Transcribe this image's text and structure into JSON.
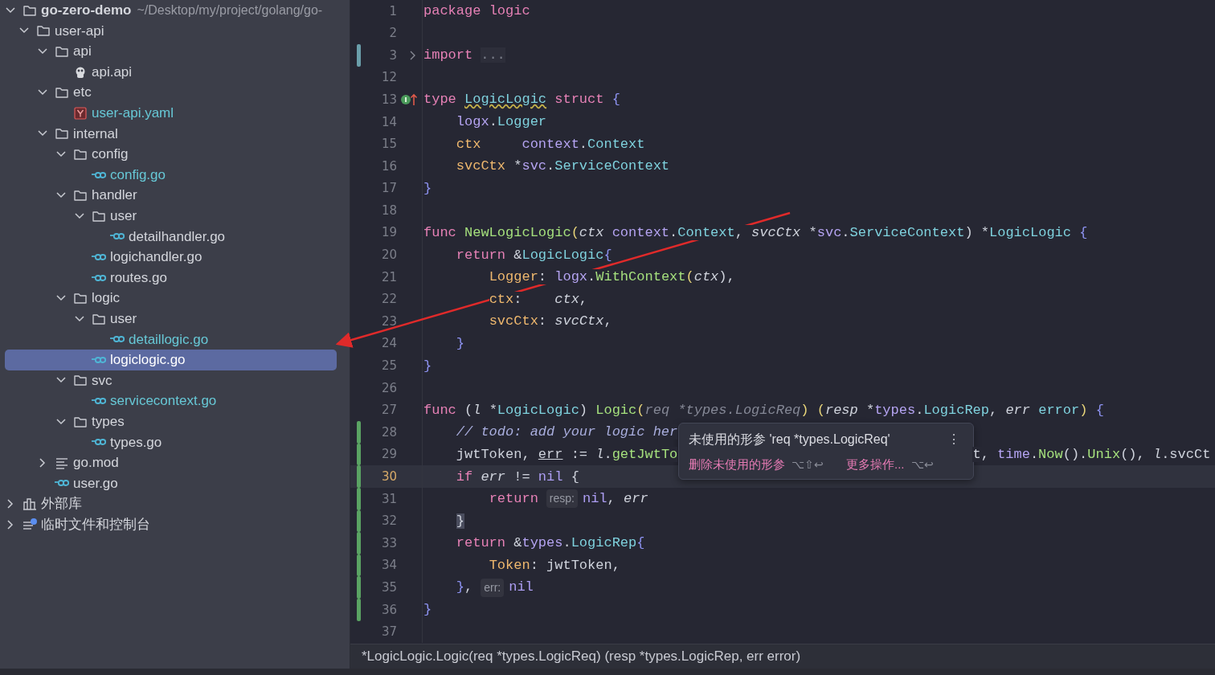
{
  "tree": [
    {
      "name": "go-zero-demo",
      "path": "~/Desktop/my/project/golang/go-",
      "kind": "folder",
      "expanded": true,
      "selected": false,
      "children": [
        {
          "name": "user-api",
          "kind": "folder",
          "expanded": true,
          "selected": false,
          "children": [
            {
              "name": "api",
              "kind": "folder",
              "expanded": true,
              "selected": false,
              "children": [
                {
                  "name": "api.api",
                  "kind": "api",
                  "selected": false,
                  "vcs_new": false
                }
              ]
            },
            {
              "name": "etc",
              "kind": "folder",
              "expanded": true,
              "selected": false,
              "children": [
                {
                  "name": "user-api.yaml",
                  "kind": "yaml",
                  "selected": false,
                  "vcs_new": true
                }
              ]
            },
            {
              "name": "internal",
              "kind": "folder",
              "expanded": true,
              "selected": false,
              "children": [
                {
                  "name": "config",
                  "kind": "folder",
                  "expanded": true,
                  "selected": false,
                  "children": [
                    {
                      "name": "config.go",
                      "kind": "go",
                      "selected": false,
                      "vcs_new": true
                    }
                  ]
                },
                {
                  "name": "handler",
                  "kind": "folder",
                  "expanded": true,
                  "selected": false,
                  "children": [
                    {
                      "name": "user",
                      "kind": "folder",
                      "expanded": true,
                      "selected": false,
                      "children": [
                        {
                          "name": "detailhandler.go",
                          "kind": "go",
                          "selected": false,
                          "vcs_new": false
                        }
                      ]
                    },
                    {
                      "name": "logichandler.go",
                      "kind": "go",
                      "selected": false,
                      "vcs_new": false
                    },
                    {
                      "name": "routes.go",
                      "kind": "go",
                      "selected": false,
                      "vcs_new": false
                    }
                  ]
                },
                {
                  "name": "logic",
                  "kind": "folder",
                  "expanded": true,
                  "selected": false,
                  "children": [
                    {
                      "name": "user",
                      "kind": "folder",
                      "expanded": true,
                      "selected": false,
                      "children": [
                        {
                          "name": "detaillogic.go",
                          "kind": "go",
                          "selected": false,
                          "vcs_new": true
                        }
                      ]
                    },
                    {
                      "name": "logiclogic.go",
                      "kind": "go",
                      "selected": true,
                      "vcs_new": false
                    }
                  ]
                },
                {
                  "name": "svc",
                  "kind": "folder",
                  "expanded": true,
                  "selected": false,
                  "children": [
                    {
                      "name": "servicecontext.go",
                      "kind": "go",
                      "selected": false,
                      "vcs_new": true
                    }
                  ]
                },
                {
                  "name": "types",
                  "kind": "folder",
                  "expanded": true,
                  "selected": false,
                  "children": [
                    {
                      "name": "types.go",
                      "kind": "go",
                      "selected": false,
                      "vcs_new": false
                    }
                  ]
                }
              ]
            },
            {
              "name": "go.mod",
              "kind": "mod",
              "expanded": false,
              "selected": false
            },
            {
              "name": "user.go",
              "kind": "go",
              "selected": false,
              "vcs_new": false
            }
          ]
        }
      ]
    },
    {
      "name": "外部库",
      "kind": "library",
      "expanded": false,
      "selected": false
    },
    {
      "name": "临时文件和控制台",
      "kind": "scratch",
      "expanded": false,
      "selected": false
    }
  ],
  "lines": [
    {
      "n": "1",
      "t": [
        {
          "text": "package",
          "kind": "kw"
        },
        {
          "text": " logic",
          "kind": "kw"
        }
      ]
    },
    {
      "n": "2"
    },
    {
      "n": "3",
      "folded": true,
      "color": "#6a9eaa",
      "t": [
        {
          "text": "import",
          "kind": "kw"
        },
        {
          "text": "...",
          "kind": "fold"
        }
      ]
    },
    {
      "n": "12"
    },
    {
      "n": "13",
      "implements_marker": true,
      "t": [
        {
          "text": "type ",
          "kind": "kw"
        },
        {
          "text": "LogicLogic",
          "kind": "typew"
        },
        {
          "text": " struct",
          "kind": "kw"
        },
        {
          "text": " {",
          "kind": "brace"
        }
      ]
    },
    {
      "n": "14",
      "t": [
        {
          "text": "    logx",
          "kind": "pkg"
        },
        {
          "text": ".",
          "kind": "plain"
        },
        {
          "text": "Logger",
          "kind": "type"
        }
      ]
    },
    {
      "n": "15",
      "t": [
        {
          "text": "    ctx",
          "kind": "field"
        },
        {
          "text": "     context",
          "kind": "pkg"
        },
        {
          "text": ".",
          "kind": "plain"
        },
        {
          "text": "Context",
          "kind": "type"
        }
      ]
    },
    {
      "n": "16",
      "t": [
        {
          "text": "    svcCtx",
          "kind": "field"
        },
        {
          "text": " *",
          "kind": "plain"
        },
        {
          "text": "svc",
          "kind": "pkg"
        },
        {
          "text": ".",
          "kind": "plain"
        },
        {
          "text": "ServiceContext",
          "kind": "type"
        }
      ]
    },
    {
      "n": "17",
      "t": [
        {
          "text": "}",
          "kind": "brace"
        }
      ]
    },
    {
      "n": "18"
    },
    {
      "n": "19",
      "t": [
        {
          "text": "func",
          "kind": "kw"
        },
        {
          "text": " NewLogicLogic",
          "kind": "fn"
        },
        {
          "text": "(",
          "kind": "paren"
        },
        {
          "text": "ctx",
          "kind": "param"
        },
        {
          "text": " context",
          "kind": "pkg"
        },
        {
          "text": ".",
          "kind": "plain"
        },
        {
          "text": "Context",
          "kind": "type"
        },
        {
          "text": ", ",
          "kind": "plain"
        },
        {
          "text": "svcCtx",
          "kind": "param"
        },
        {
          "text": " *",
          "kind": "plain"
        },
        {
          "text": "svc",
          "kind": "pkg"
        },
        {
          "text": ".",
          "kind": "plain"
        },
        {
          "text": "ServiceContext",
          "kind": "type"
        },
        {
          "text": ") *",
          "kind": "plain"
        },
        {
          "text": "LogicLogic",
          "kind": "type"
        },
        {
          "text": " {",
          "kind": "brace"
        }
      ]
    },
    {
      "n": "20",
      "t": [
        {
          "text": "    return",
          "kind": "kw"
        },
        {
          "text": " &",
          "kind": "plain"
        },
        {
          "text": "LogicLogic",
          "kind": "type"
        },
        {
          "text": "{",
          "kind": "brace"
        }
      ]
    },
    {
      "n": "21",
      "t": [
        {
          "text": "        Logger",
          "kind": "field"
        },
        {
          "text": ": ",
          "kind": "plain"
        },
        {
          "text": "logx",
          "kind": "pkg"
        },
        {
          "text": ".",
          "kind": "plain"
        },
        {
          "text": "WithContext",
          "kind": "fn"
        },
        {
          "text": "(",
          "kind": "paren"
        },
        {
          "text": "ctx",
          "kind": "param"
        },
        {
          "text": "),",
          "kind": "plain"
        }
      ]
    },
    {
      "n": "22",
      "t": [
        {
          "text": "        ctx",
          "kind": "field"
        },
        {
          "text": ":    ",
          "kind": "plain"
        },
        {
          "text": "ctx",
          "kind": "param"
        },
        {
          "text": ",",
          "kind": "plain"
        }
      ]
    },
    {
      "n": "23",
      "t": [
        {
          "text": "        svcCtx",
          "kind": "field"
        },
        {
          "text": ": ",
          "kind": "plain"
        },
        {
          "text": "svcCtx",
          "kind": "param"
        },
        {
          "text": ",",
          "kind": "plain"
        }
      ]
    },
    {
      "n": "24",
      "t": [
        {
          "text": "    }",
          "kind": "brace"
        }
      ]
    },
    {
      "n": "25",
      "t": [
        {
          "text": "}",
          "kind": "brace"
        }
      ]
    },
    {
      "n": "26"
    },
    {
      "n": "27",
      "t": [
        {
          "text": "func",
          "kind": "kw"
        },
        {
          "text": " (",
          "kind": "plain"
        },
        {
          "text": "l",
          "kind": "param"
        },
        {
          "text": " *",
          "kind": "plain"
        },
        {
          "text": "LogicLogic",
          "kind": "type"
        },
        {
          "text": ") ",
          "kind": "plain"
        },
        {
          "text": "Logic",
          "kind": "fn"
        },
        {
          "text": "(",
          "kind": "paren"
        },
        {
          "text": "req *types.LogicReq",
          "kind": "unused"
        },
        {
          "text": ") (",
          "kind": "paren"
        },
        {
          "text": "resp",
          "kind": "param"
        },
        {
          "text": " *",
          "kind": "plain"
        },
        {
          "text": "types",
          "kind": "pkg"
        },
        {
          "text": ".",
          "kind": "plain"
        },
        {
          "text": "LogicRep",
          "kind": "type"
        },
        {
          "text": ", ",
          "kind": "plain"
        },
        {
          "text": "err",
          "kind": "param"
        },
        {
          "text": " error",
          "kind": "type"
        },
        {
          "text": ") ",
          "kind": "paren"
        },
        {
          "text": "{",
          "kind": "brace"
        }
      ]
    },
    {
      "n": "28",
      "color": "#5aa363",
      "t": [
        {
          "text": "    // todo: add your logic her",
          "kind": "comment"
        }
      ]
    },
    {
      "n": "29",
      "color": "#5aa363",
      "t": [
        {
          "text": "    jwtToken, ",
          "kind": "plain"
        },
        {
          "text": "err",
          "kind": "ul"
        },
        {
          "text": " := ",
          "kind": "plain"
        },
        {
          "text": "l",
          "kind": "param"
        },
        {
          "text": ".",
          "kind": "plain"
        },
        {
          "text": "getJwtTo",
          "kind": "fn"
        }
      ],
      "tail": [
        {
          "text": "t, ",
          "kind": "plain"
        },
        {
          "text": "time",
          "kind": "pkg"
        },
        {
          "text": ".",
          "kind": "plain"
        },
        {
          "text": "Now",
          "kind": "fn"
        },
        {
          "text": "().",
          "kind": "plain"
        },
        {
          "text": "Unix",
          "kind": "fn"
        },
        {
          "text": "(), ",
          "kind": "plain"
        },
        {
          "text": "l",
          "kind": "param"
        },
        {
          "text": ".",
          "kind": "plain"
        },
        {
          "text": "svcCt",
          "kind": "plain"
        }
      ]
    },
    {
      "n": "30",
      "color": "#5aa363",
      "current": true,
      "t": [
        {
          "text": "    if",
          "kind": "kw"
        },
        {
          "text": " err",
          "kind": "param"
        },
        {
          "text": " != ",
          "kind": "plain"
        },
        {
          "text": "nil ",
          "kind": "const"
        },
        {
          "text": "{",
          "kind": "bracesel"
        }
      ]
    },
    {
      "n": "31",
      "color": "#5aa363",
      "t": [
        {
          "text": "        return",
          "kind": "kw"
        },
        {
          "text": "resp:",
          "kind": "hint"
        },
        {
          "text": "nil",
          "kind": "const"
        },
        {
          "text": ", ",
          "kind": "plain"
        },
        {
          "text": "err",
          "kind": "param"
        }
      ]
    },
    {
      "n": "32",
      "color": "#5aa363",
      "t": [
        {
          "text": "    }",
          "kind": "bracesel"
        }
      ]
    },
    {
      "n": "33",
      "color": "#5aa363",
      "t": [
        {
          "text": "    return",
          "kind": "kw"
        },
        {
          "text": " &",
          "kind": "plain"
        },
        {
          "text": "types",
          "kind": "pkg"
        },
        {
          "text": ".",
          "kind": "plain"
        },
        {
          "text": "LogicRep",
          "kind": "type"
        },
        {
          "text": "{",
          "kind": "brace"
        }
      ]
    },
    {
      "n": "34",
      "color": "#5aa363",
      "t": [
        {
          "text": "        Token",
          "kind": "field"
        },
        {
          "text": ": jwtToken,",
          "kind": "plain"
        }
      ]
    },
    {
      "n": "35",
      "color": "#5aa363",
      "t": [
        {
          "text": "    }",
          "kind": "brace"
        },
        {
          "text": ",",
          "kind": "plain"
        },
        {
          "text": "err:",
          "kind": "hint"
        },
        {
          "text": "nil",
          "kind": "const"
        }
      ]
    },
    {
      "n": "36",
      "color": "#5aa363",
      "t": [
        {
          "text": "}",
          "kind": "brace"
        }
      ]
    },
    {
      "n": "37"
    }
  ],
  "popup": {
    "message": "未使用的形参 'req *types.LogicReq'",
    "menu_glyph": "⋮",
    "actions": [
      {
        "label": "删除未使用的形参",
        "shortcut": "⌥⇧↩"
      },
      {
        "label": "更多操作...",
        "shortcut": "⌥↩"
      }
    ]
  },
  "status_bar": "*LogicLogic.Logic(req *types.LogicReq) (resp *types.LogicRep, err error)"
}
